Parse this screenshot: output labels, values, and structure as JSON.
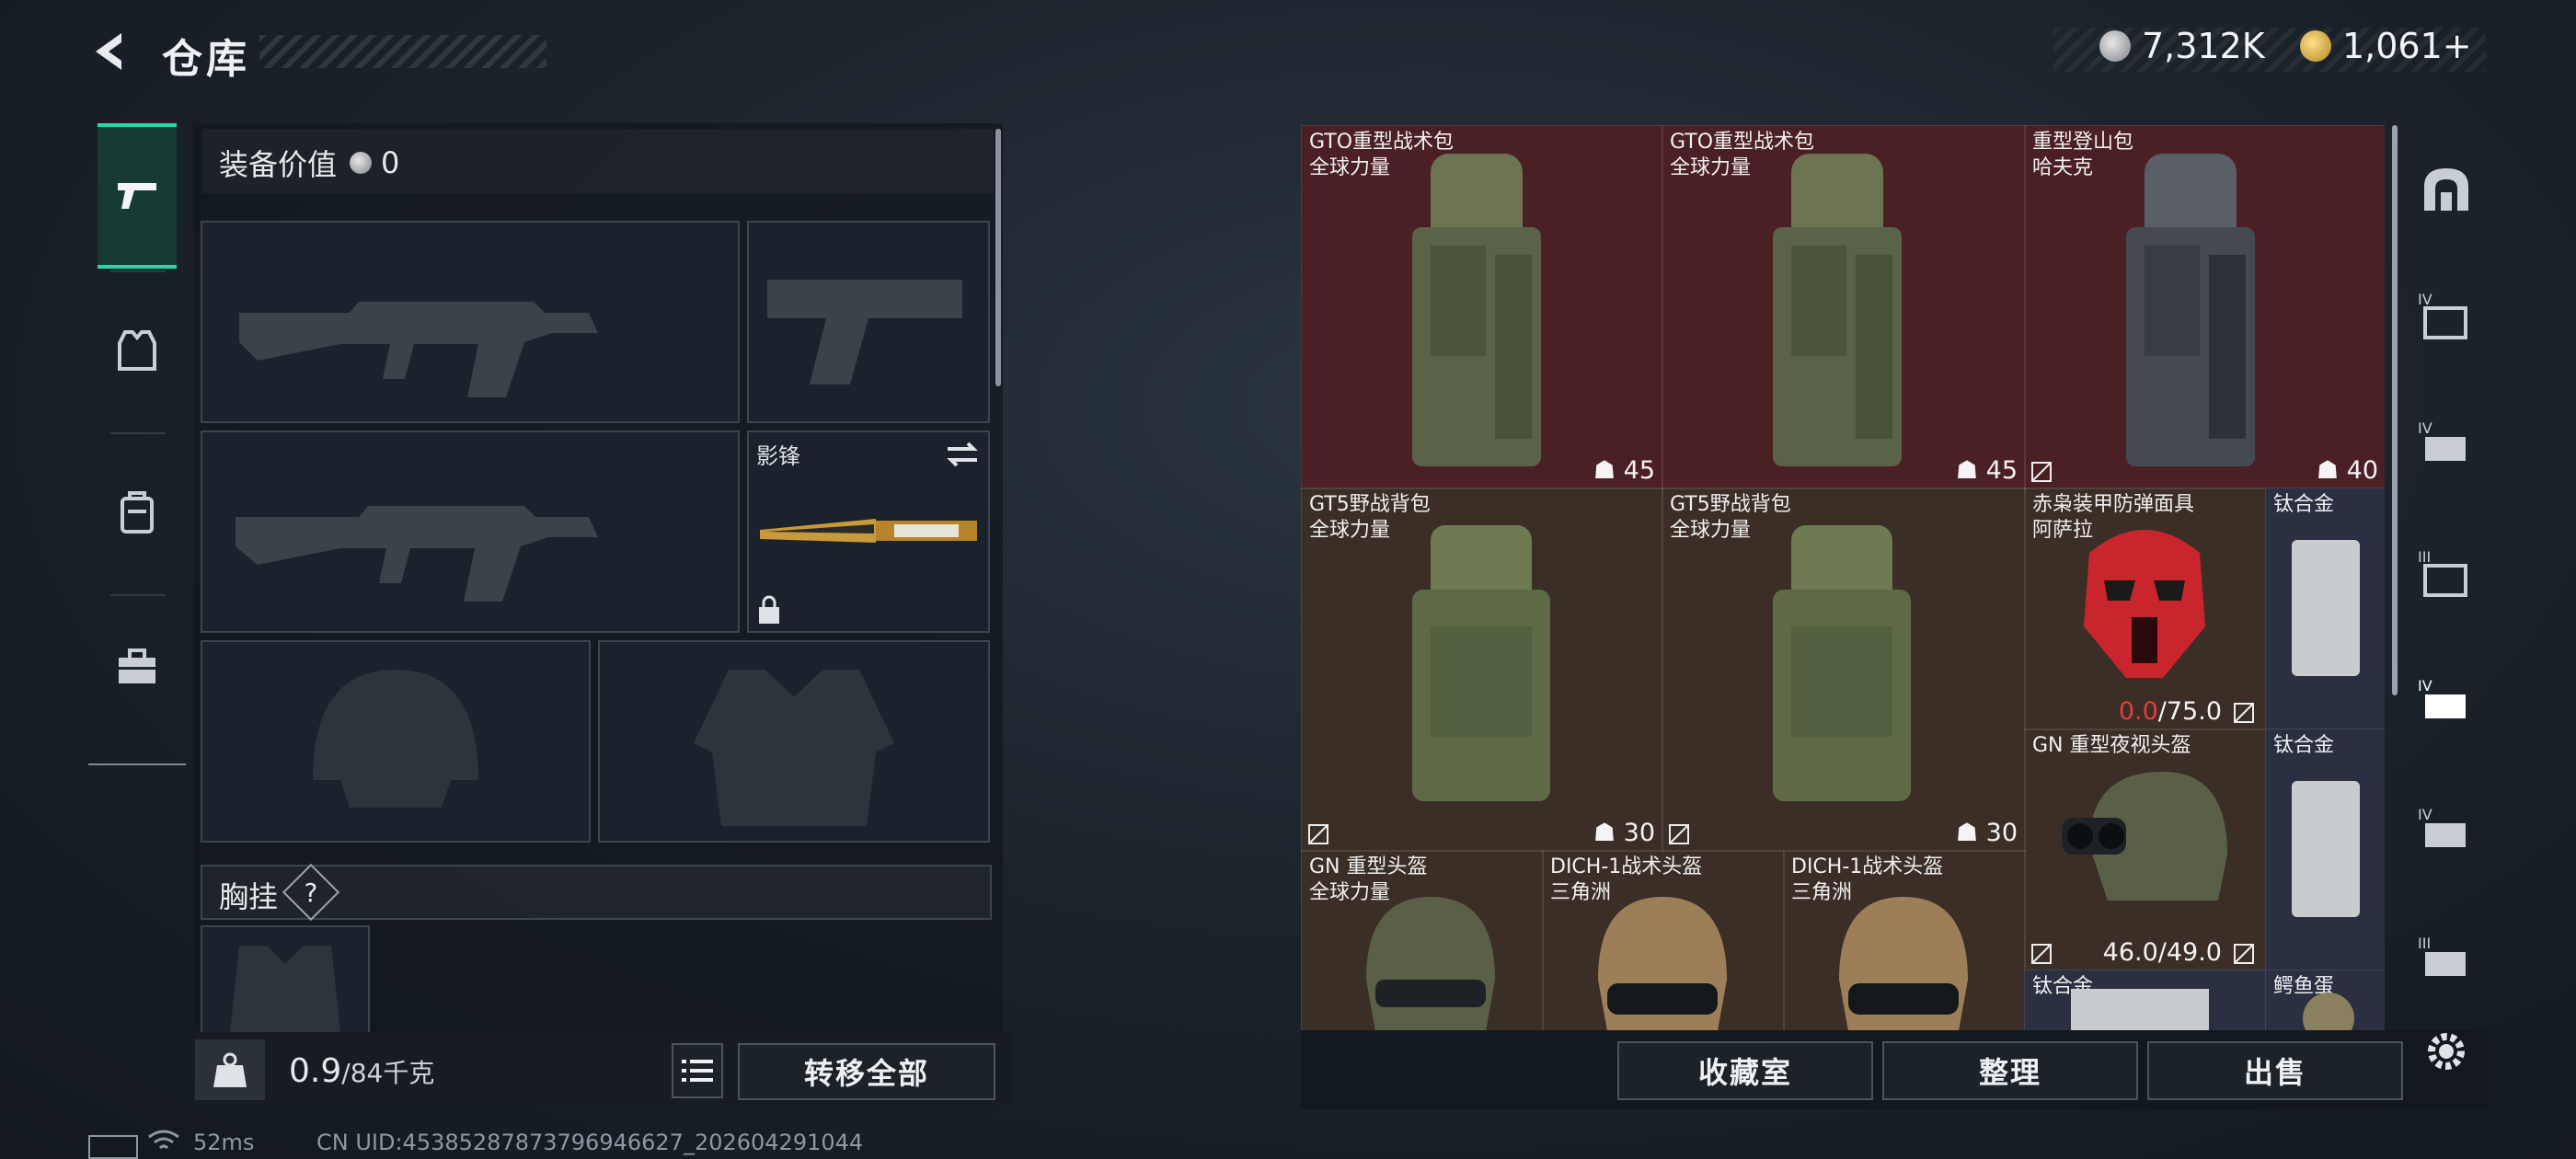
{
  "header": {
    "title": "仓库",
    "currency1": "7,312K",
    "currency2": "1,061+"
  },
  "equipment": {
    "value_label": "装备价值",
    "value": "0",
    "secondary_slot_name": "影锋",
    "chest_label": "胸挂",
    "chest_help": "?"
  },
  "footer": {
    "weight_current": "0.9",
    "weight_max": "/84千克",
    "transfer_all": "转移全部"
  },
  "grid_items": [
    {
      "name": "GTO重型战术包",
      "source": "全球力量",
      "qty": "45"
    },
    {
      "name": "GTO重型战术包",
      "source": "全球力量",
      "qty": "45"
    },
    {
      "name": "重型登山包",
      "source": "哈夫克",
      "qty": "40"
    },
    {
      "name": "GT5野战背包",
      "source": "全球力量",
      "qty": "30"
    },
    {
      "name": "GT5野战背包",
      "source": "全球力量",
      "qty": "30"
    },
    {
      "name": "赤枭装甲防弹面具",
      "source": "阿萨拉",
      "durability_current": "0.0",
      "durability_max": "/75.0"
    },
    {
      "name": "钛合金"
    },
    {
      "name": "GN 重型夜视头盔",
      "durability": "46.0/49.0"
    },
    {
      "name": "钛合金"
    },
    {
      "name": "GN 重型头盔",
      "source": "全球力量"
    },
    {
      "name": "DICH-1战术头盔",
      "source": "三角洲"
    },
    {
      "name": "DICH-1战术头盔",
      "source": "三角洲"
    },
    {
      "name": "钛合金"
    },
    {
      "name": "鳄鱼蛋"
    }
  ],
  "actions": {
    "collection": "收藏室",
    "sort": "整理",
    "sell": "出售"
  },
  "status": {
    "ping": "52ms",
    "uid": "CN UID:45385287873796946627_202604291044"
  },
  "colors": {
    "accent": "#2fd6a4",
    "grid_red": "#4a2024",
    "grid_brown": "#3b2e26",
    "grid_blue": "#2a3042",
    "durability_zero": "#e53b3b"
  }
}
